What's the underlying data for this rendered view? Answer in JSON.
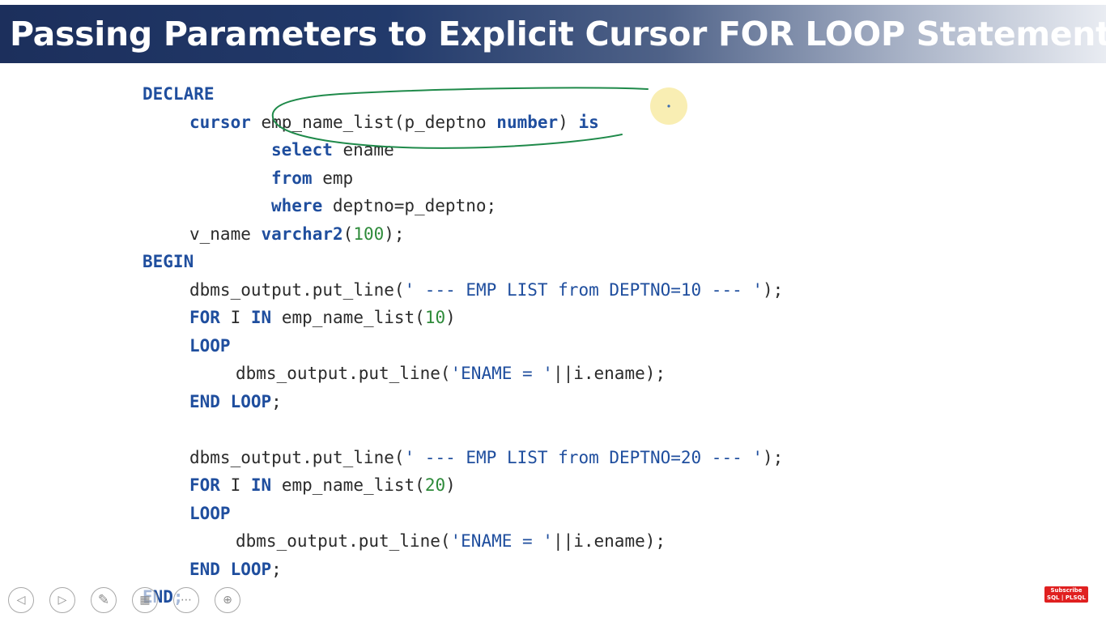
{
  "slide": {
    "title": "Passing Parameters to Explicit Cursor FOR LOOP Statement"
  },
  "code": {
    "l1": {
      "a": "DECLARE"
    },
    "l2": {
      "a": "cursor",
      "b": " emp_name_list(p_deptno ",
      "c": "number",
      "d": ") ",
      "e": "is"
    },
    "l3": {
      "a": "select",
      "b": " ename"
    },
    "l4": {
      "a": "from",
      "b": " emp"
    },
    "l5": {
      "a": "where",
      "b": " deptno=p_deptno;"
    },
    "l6": {
      "a": "v_name ",
      "b": "varchar2",
      "c": "(",
      "d": "100",
      "e": ");"
    },
    "l7": {
      "a": "BEGIN"
    },
    "l8": {
      "a": "dbms_output.put_line(",
      "b": "' --- EMP LIST from DEPTNO=10 --- '",
      "c": ");"
    },
    "l9": {
      "a": "FOR",
      "b": " I ",
      "c": "IN",
      "d": " emp_name_list(",
      "e": "10",
      "f": ")"
    },
    "l10": {
      "a": "LOOP"
    },
    "l11": {
      "a": "dbms_output.put_line(",
      "b": "'ENAME = '",
      "c": "||i.ename);"
    },
    "l12": {
      "a": "END LOOP",
      "b": ";"
    },
    "l13": {
      "a": "dbms_output.put_line(",
      "b": "' --- EMP LIST from DEPTNO=20 --- '",
      "c": ");"
    },
    "l14": {
      "a": "FOR",
      "b": " I ",
      "c": "IN",
      "d": " emp_name_list(",
      "e": "20",
      "f": ")"
    },
    "l15": {
      "a": "LOOP"
    },
    "l16": {
      "a": "dbms_output.put_line(",
      "b": "'ENAME = '",
      "c": "||i.ename);"
    },
    "l17": {
      "a": "END LOOP",
      "b": ";"
    },
    "l18": {
      "a": "END;"
    }
  },
  "controls": {
    "prev_icon": "◁",
    "next_icon": "▷",
    "pen_icon": "✎",
    "slides_icon": "▦",
    "more_icon": "⋯",
    "zoom_icon": "⊕"
  },
  "badge": {
    "line1": "Subscribe",
    "line2": "SQL | PLSQL"
  },
  "colors": {
    "keyword": "#1f4e9e",
    "number": "#2e8b3a",
    "annotation_ink": "#1f8a4a",
    "pointer": "#f7e89a"
  }
}
